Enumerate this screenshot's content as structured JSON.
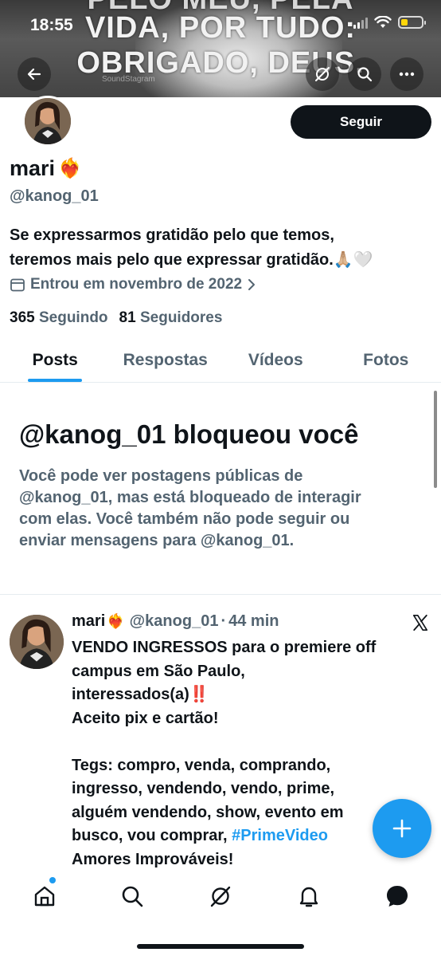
{
  "status_bar": {
    "time": "18:55"
  },
  "banner": {
    "line0": "PELO MEU, PELA",
    "line1": "VIDA, POR TUDO:",
    "line2": "OBRIGADO, DEUS.",
    "watermark": "SoundStagram"
  },
  "profile": {
    "name": "mari",
    "name_emoji": "❤️‍🔥",
    "handle": "@kanog_01",
    "follow_label": "Seguir",
    "bio_line1": "Se expressarmos gratidão pelo que temos,",
    "bio_line2": "teremos mais pelo que expressar gratidão.🙏🏼🤍",
    "joined": "Entrou em novembro de 2022",
    "following_count": "365",
    "following_label": "Seguindo",
    "followers_count": "81",
    "followers_label": "Seguidores"
  },
  "tabs": [
    {
      "label": "Posts",
      "active": true
    },
    {
      "label": "Respostas",
      "active": false
    },
    {
      "label": "Vídeos",
      "active": false
    },
    {
      "label": "Fotos",
      "active": false
    }
  ],
  "blocked": {
    "title": "@kanog_01 bloqueou você",
    "line1": "Você pode ver postagens públicas de",
    "line2": "@kanog_01, mas está bloqueado de interagir",
    "line3": "com elas. Você também não pode seguir ou",
    "line4": "enviar mensagens para @kanog_01."
  },
  "post": {
    "name": "mari",
    "name_emoji": "❤️‍🔥",
    "handle": "@kanog_01",
    "dot": "·",
    "time": "44 min",
    "l1": "VENDO INGRESSOS para o premiere off",
    "l2": "campus em São Paulo,",
    "l3": "interessados(a)",
    "l3_emoji": "‼️",
    "l4": "Aceito pix e cartão!",
    "l5": "Tegs: compro, venda, comprando,",
    "l6": "ingresso, vendendo, vendo, prime,",
    "l7": "alguém vendendo, show, evento em",
    "l8_prefix": "busco, vou comprar, ",
    "l8_hashtag": "#PrimeVideo",
    "l9": "Amores Improváveis!"
  },
  "icons": {
    "back": "back-arrow-icon",
    "grok": "grok-icon",
    "search": "search-icon",
    "more": "more-icon",
    "calendar": "calendar-icon",
    "chevron": "chevron-right-icon",
    "x_logo": "x-logo-icon",
    "compose": "plus-icon",
    "nav": [
      "home-icon",
      "search-icon",
      "grok-icon",
      "bell-icon",
      "messages-icon"
    ]
  },
  "colors": {
    "accent": "#1d9bf0",
    "text": "#0f1419",
    "secondary": "#536471"
  }
}
